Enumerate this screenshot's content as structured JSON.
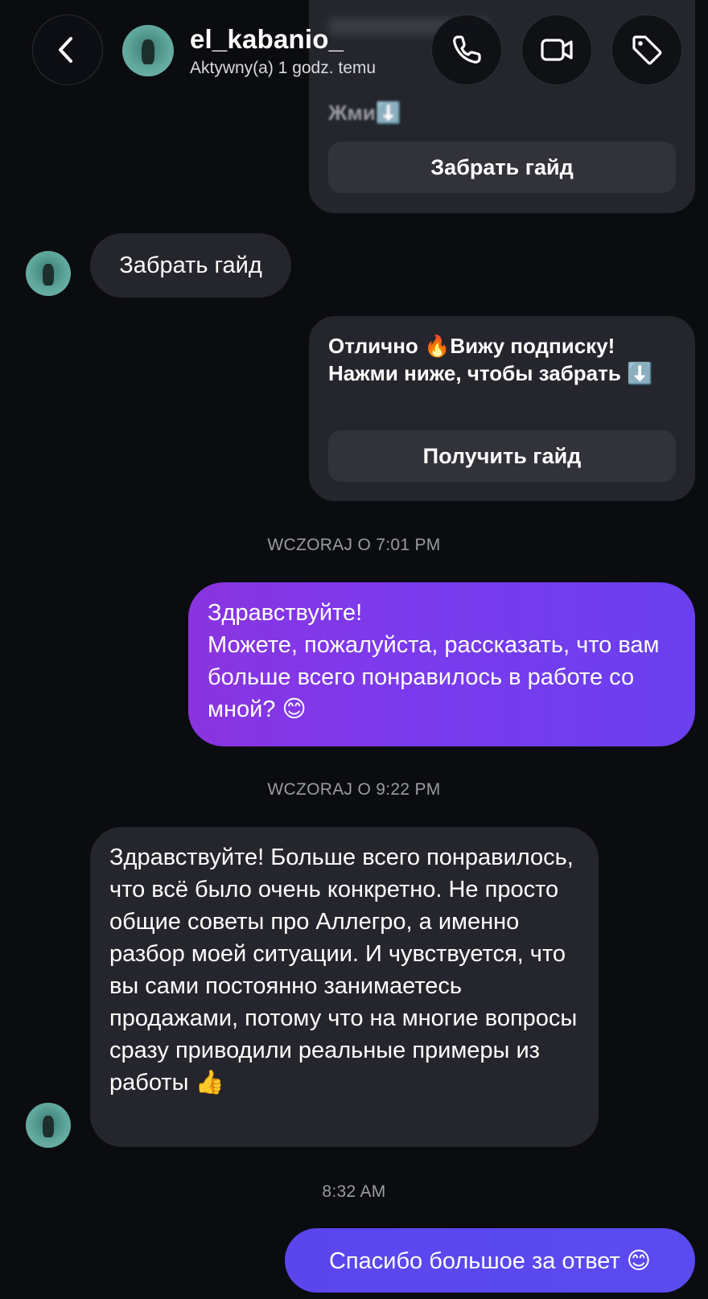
{
  "header": {
    "username": "el_kabanio_",
    "status": "Aktywny(a) 1 godz. temu"
  },
  "icons": {
    "back": "chevron-left-icon",
    "call": "phone-icon",
    "video": "video-camera-icon",
    "tag": "tag-icon"
  },
  "messages": {
    "card1_text": "Жми⬇️",
    "card1_button": "Забрать гайд",
    "reply1": "Забрать гайд",
    "card2_text": "Отлично 🔥Вижу подписку! Нажми ниже, чтобы забрать ⬇️",
    "card2_button": "Получить гайд",
    "timestamp1": "WCZORAJ O 7:01 PM",
    "out1": "Здравствуйте!\nМожете, пожалуйста, рассказать, что вам больше всего понравилось в работе со мной? 😊",
    "timestamp2": "WCZORAJ O 9:22 PM",
    "in2": "Здравствуйте! Больше всего понравилось, что всё было очень конкретно. Не просто общие советы про Аллегро, а именно разбор моей ситуации. И чувствуется, что вы сами постоянно занимаетесь продажами, потому что на многие вопросы сразу приводили реальные примеры из работы 👍",
    "timestamp3": "8:32 AM",
    "out2": "Спасибо большое за ответ 😊"
  },
  "colors": {
    "background": "#0b0c10",
    "incoming_bubble": "#25262d",
    "outgoing_gradient_start": "#8a34df",
    "outgoing_gradient_end": "#5a4bf0"
  }
}
